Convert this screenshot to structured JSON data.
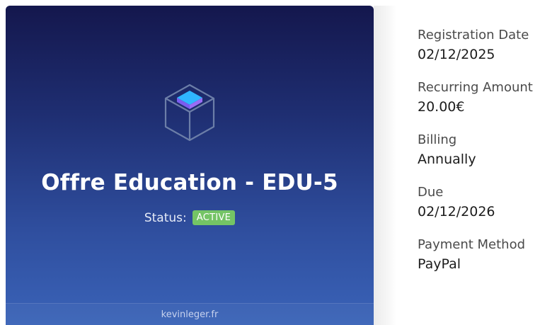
{
  "product": {
    "title": "Offre Education - EDU-5",
    "status_label": "Status:",
    "status_value": "ACTIVE",
    "status_color": "#74c465",
    "icon": "box-icon",
    "footer": "kevinleger.fr"
  },
  "details": [
    {
      "label": "Registration Date",
      "value": "02/12/2025"
    },
    {
      "label": "Recurring Amount",
      "value": "20.00€"
    },
    {
      "label": "Billing",
      "value": "Annually"
    },
    {
      "label": "Due",
      "value": "02/12/2026"
    },
    {
      "label": "Payment Method",
      "value": "PayPal"
    }
  ]
}
